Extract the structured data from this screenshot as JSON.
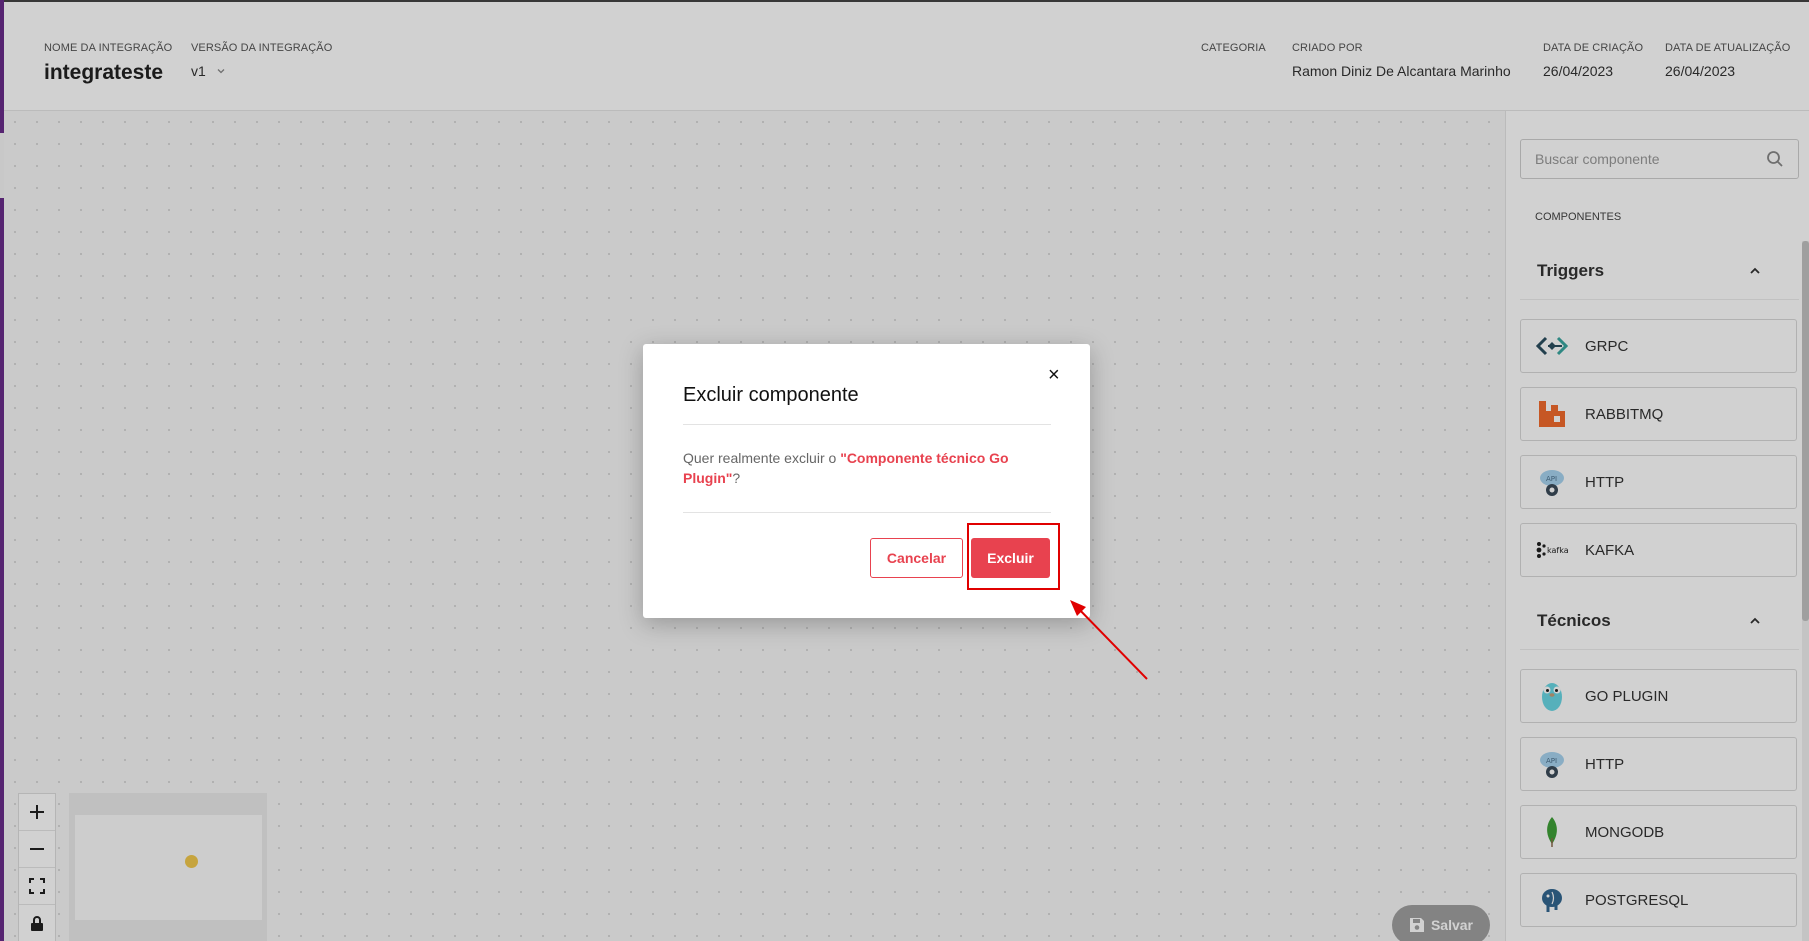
{
  "header": {
    "integration_name_label": "NOME DA INTEGRAÇÃO",
    "integration_name": "integrateste",
    "version_label": "VERSÃO DA INTEGRAÇÃO",
    "version": "v1",
    "category_label": "CATEGORIA",
    "created_by_label": "CRIADO POR",
    "created_by": "Ramon Diniz De Alcantara Marinho",
    "created_date_label": "DATA DE CRIAÇÃO",
    "created_date": "26/04/2023",
    "updated_date_label": "DATA DE ATUALIZAÇÃO",
    "updated_date": "26/04/2023"
  },
  "canvas": {
    "zoom_in": "+",
    "zoom_out": "—",
    "save_label": "Salvar"
  },
  "sidebar": {
    "search_placeholder": "Buscar componente",
    "components_label": "COMPONENTES",
    "sections": [
      {
        "title": "Triggers",
        "items": [
          "GRPC",
          "RABBITMQ",
          "HTTP",
          "KAFKA"
        ]
      },
      {
        "title": "Técnicos",
        "items": [
          "GO PLUGIN",
          "HTTP",
          "MONGODB",
          "POSTGRESQL"
        ]
      }
    ],
    "kafka_logo_text": "kafka"
  },
  "modal": {
    "title": "Excluir componente",
    "close": "×",
    "body_prefix": "Quer realmente excluir o ",
    "body_highlight": "\"Componente técnico Go Plugin\"",
    "body_suffix": "?",
    "cancel_label": "Cancelar",
    "delete_label": "Excluir"
  },
  "colors": {
    "accent": "#e8424f",
    "sidebar_stripe": "#6a2c8a",
    "annotation": "#e00000"
  }
}
